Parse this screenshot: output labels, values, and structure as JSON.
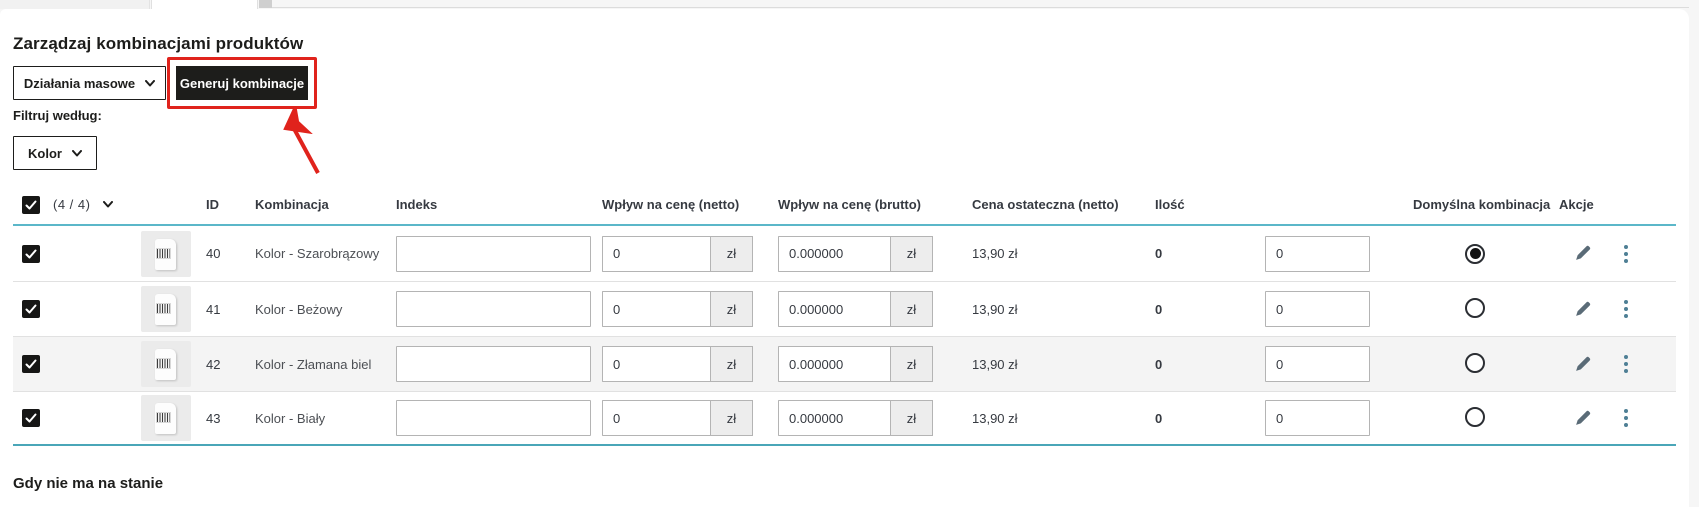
{
  "page": {
    "title": "Zarządzaj kombinacjami produktów",
    "bulk_actions_label": "Działania masowe",
    "generate_button_label": "Generuj kombinacje",
    "filter_label": "Filtruj według:",
    "filter_selected_value": "Kolor",
    "footer_heading": "Gdy nie ma na stanie"
  },
  "colors": {
    "annotation_red": "#e0231c",
    "button_black": "#1d1d1b",
    "header_underline_teal": "#5bb7c9",
    "table_bottom_teal": "#4aa6b8"
  },
  "table": {
    "selection_count": "(4 / 4)",
    "currency_suffix": "zł",
    "columns": {
      "id": "ID",
      "combination": "Kombinacja",
      "index": "Indeks",
      "impact_netto": "Wpływ na cenę (netto)",
      "impact_brutto": "Wpływ na cenę (brutto)",
      "final_price": "Cena ostateczna (netto)",
      "stock": "Ilość",
      "default": "Domyślna kombinacja",
      "actions": "Akcje"
    },
    "rows": [
      {
        "id": "40",
        "combination": "Kolor - Szarobrązowy",
        "index_value": "",
        "impact_netto": "0",
        "impact_brutto": "0.000000",
        "final_price": "13,90 zł",
        "stock": "0",
        "quantity": "0",
        "is_default": true
      },
      {
        "id": "41",
        "combination": "Kolor - Beżowy",
        "index_value": "",
        "impact_netto": "0",
        "impact_brutto": "0.000000",
        "final_price": "13,90 zł",
        "stock": "0",
        "quantity": "0",
        "is_default": false
      },
      {
        "id": "42",
        "combination": "Kolor - Złamana biel",
        "index_value": "",
        "impact_netto": "0",
        "impact_brutto": "0.000000",
        "final_price": "13,90 zł",
        "stock": "0",
        "quantity": "0",
        "is_default": false
      },
      {
        "id": "43",
        "combination": "Kolor - Biały",
        "index_value": "",
        "impact_netto": "0",
        "impact_brutto": "0.000000",
        "final_price": "13,90 zł",
        "stock": "0",
        "quantity": "0",
        "is_default": false
      }
    ]
  }
}
